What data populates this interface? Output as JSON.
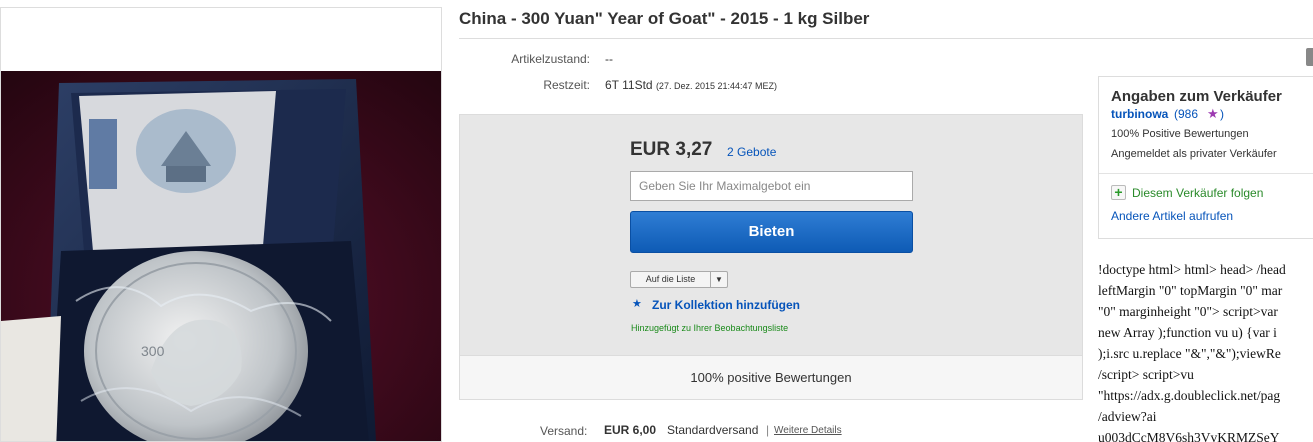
{
  "listing": {
    "title": "China - 300 Yuan\" Year of Goat\" - 2015 - 1 kg Silber",
    "condition_label": "Artikelzustand:",
    "condition_value": "--",
    "time_left_label": "Restzeit:",
    "time_left_value": "6T 11Std",
    "end_time": "(27. Dez. 2015   21:44:47 MEZ)"
  },
  "bid": {
    "price": "EUR 3,27",
    "bid_count": "2 Gebote",
    "max_bid_placeholder": "Geben Sie Ihr Maximalgebot ein",
    "bid_button": "Bieten",
    "watch_dropdown": "Auf die Liste",
    "add_collection": "Zur Kollektion hinzufügen",
    "watch_added": "Hinzugefügt zu Ihrer Beobachtungsliste",
    "positive_feedback": "100% positive Bewertungen"
  },
  "seller": {
    "title": "Angaben zum Verkäufer",
    "name": "turbinowa",
    "score_open": "(986",
    "score_close": ")",
    "positive": "100% Positive Bewertungen",
    "type": "Angemeldet als privater Verkäufer",
    "follow": "Diesem Verkäufer folgen",
    "other_items": "Andere Artikel aufrufen"
  },
  "shipping": {
    "label": "Versand:",
    "price": "EUR 6,00",
    "method": "Standardversand",
    "separator": "|",
    "details": "Weitere Details"
  },
  "raw_code_lines": [
    "!doctype html> html> head> /head",
    "leftMargin \"0\" topMargin \"0\" mar",
    "\"0\" marginheight \"0\"> script>var",
    "new Array );function vu u) {var i",
    ");i.src u.replace \"&\",\"&\");viewRe",
    "/script> script>vu",
    "\"https://adx.g.doubleclick.net/pag",
    "/adview?ai",
    "u003dCcM8V6sh3VvKRMZSeY"
  ],
  "colors": {
    "link": "#0654ba",
    "bid_button": "#0e5bb5",
    "green": "#2a8a2a",
    "star": "#9d3bb1"
  }
}
